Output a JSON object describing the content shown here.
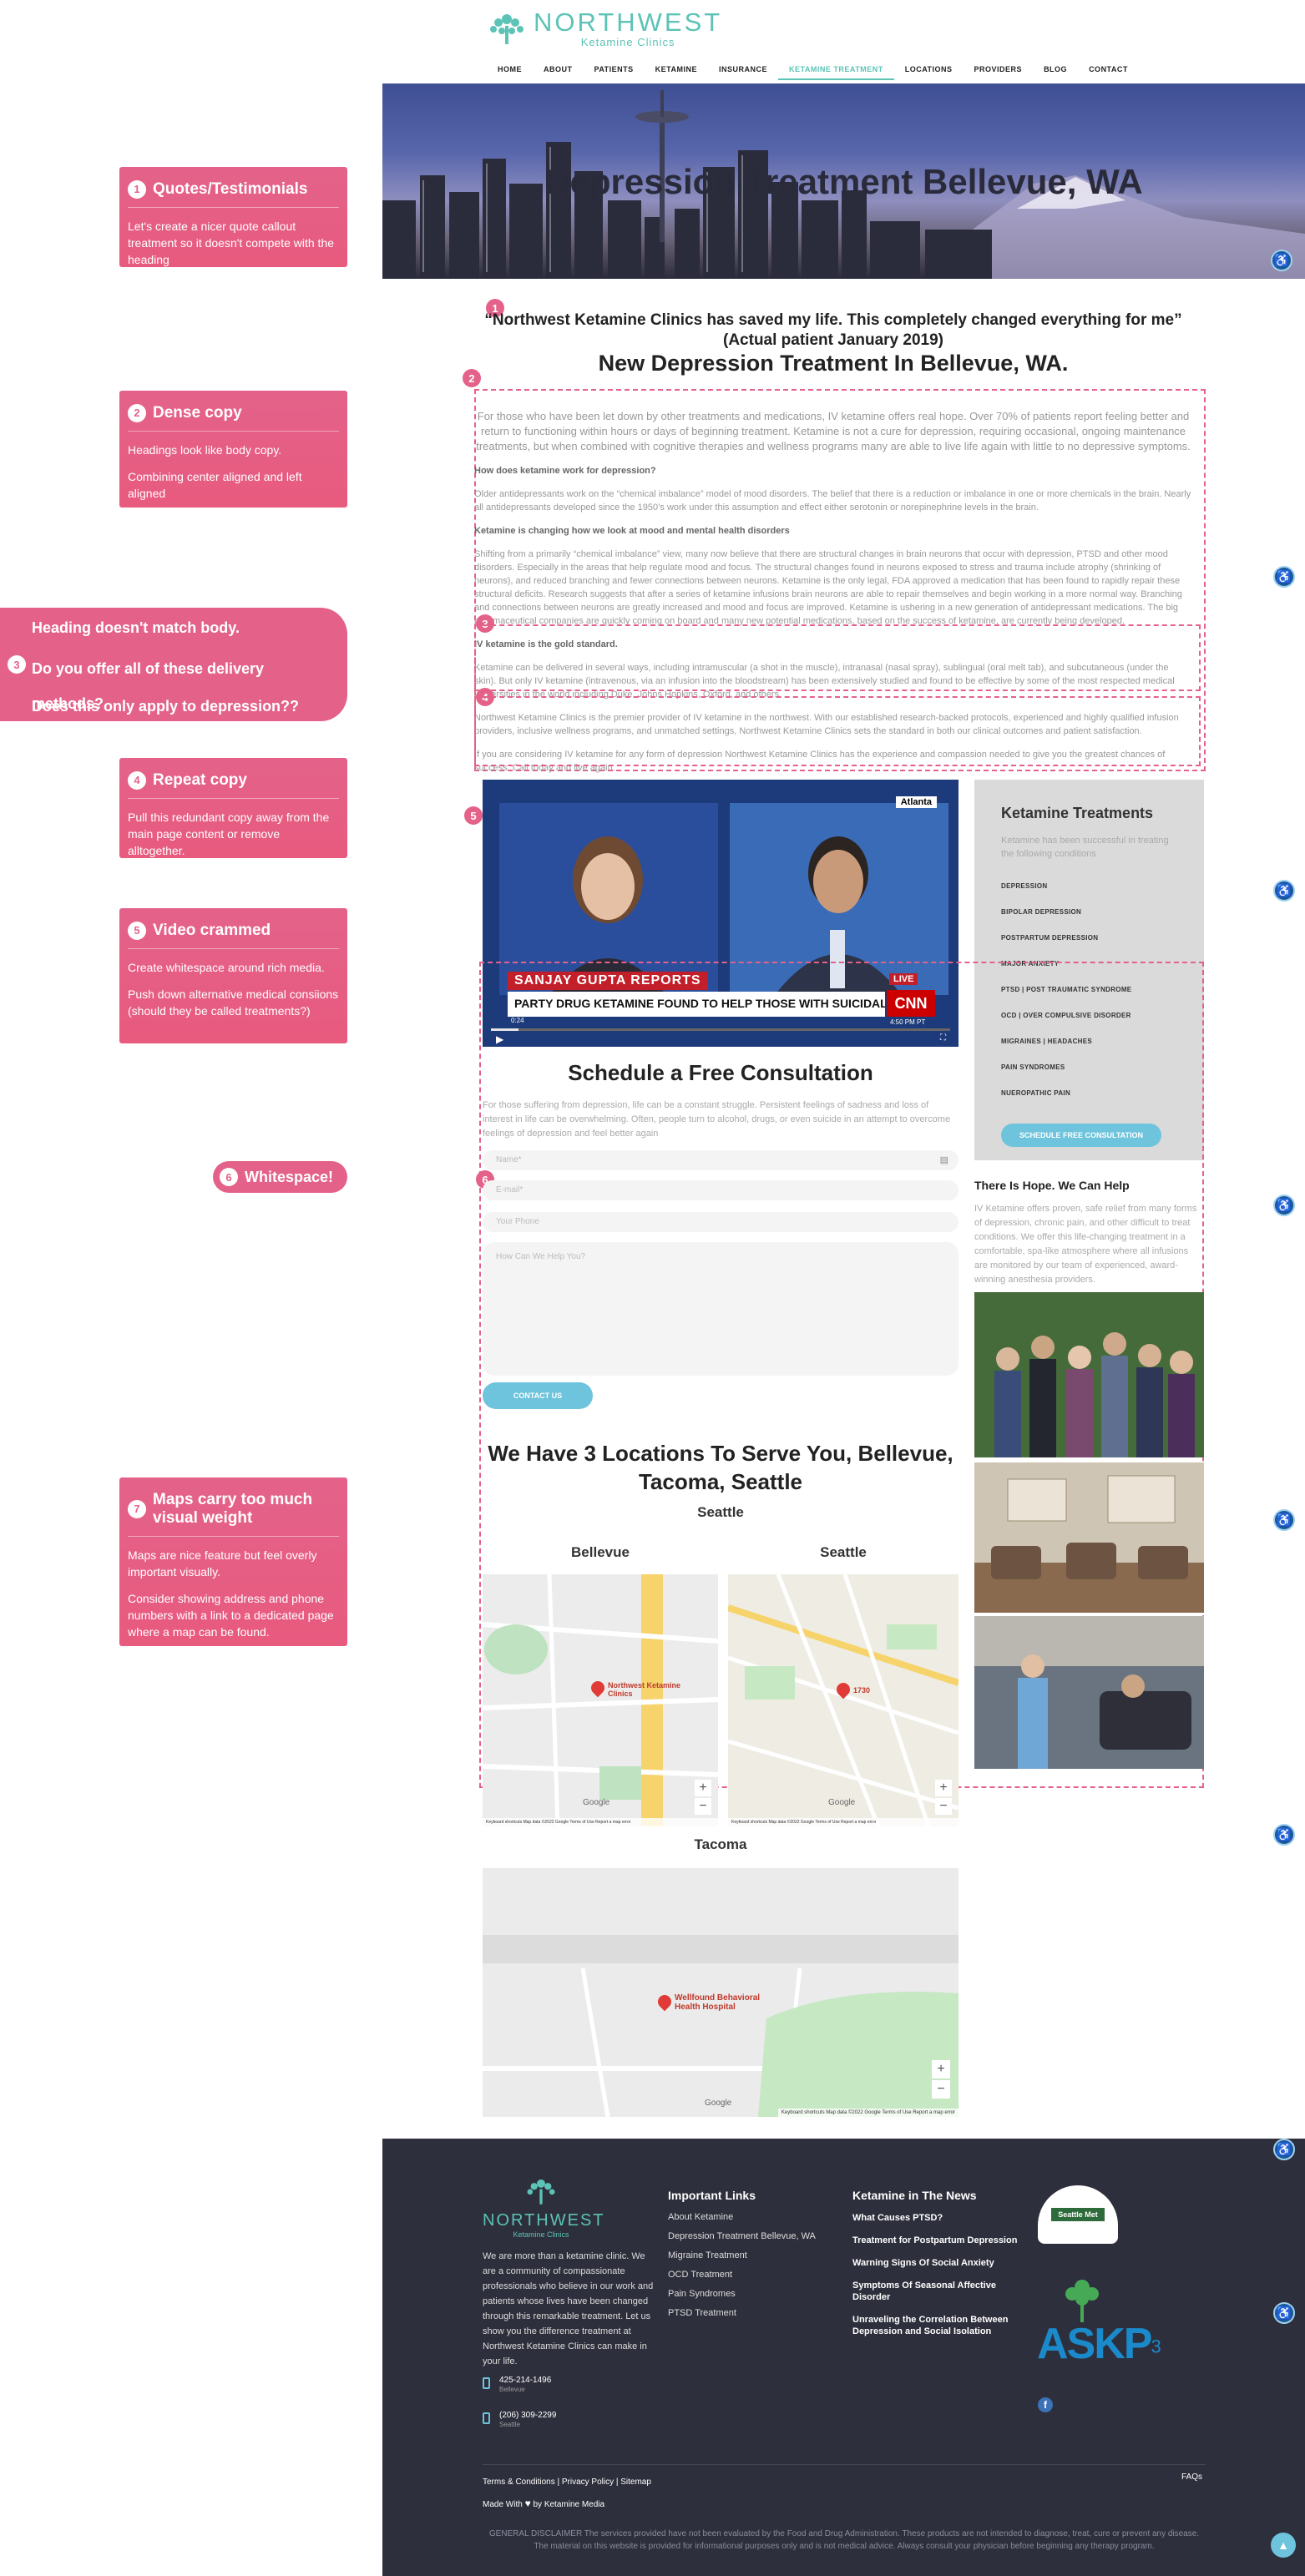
{
  "annotations": [
    {
      "num": "1",
      "title": "Quotes/Testimonials",
      "body": [
        "Let's create a nicer quote callout treatment so it doesn't compete with the heading"
      ]
    },
    {
      "num": "2",
      "title": "Dense copy",
      "body": [
        "Headings look like body copy.",
        "Combining center aligned and left aligned"
      ]
    },
    {
      "num": "3",
      "lines": [
        "Heading doesn't match body.",
        "Do you offer all of these delivery methods?",
        "Does this only apply to depression??"
      ]
    },
    {
      "num": "4",
      "title": "Repeat copy",
      "body": [
        "Pull this redundant copy away from the main page content or remove alltogether."
      ]
    },
    {
      "num": "5",
      "title": "Video crammed",
      "body": [
        "Create whitespace around rich media.",
        "Push down alternative medical consiions (should they be called treatments?)"
      ]
    },
    {
      "num": "6",
      "title": "Whitespace!"
    },
    {
      "num": "7",
      "title": "Maps carry too much visual weight",
      "body": [
        "Maps are nice feature but feel overly important visually.",
        "Consider showing address and phone numbers with a link to a dedicated page where a map can be found."
      ]
    }
  ],
  "logo": {
    "name": "NORTHWEST",
    "sub": "Ketamine Clinics"
  },
  "nav": [
    "HOME",
    "ABOUT",
    "PATIENTS",
    "KETAMINE",
    "INSURANCE",
    "KETAMINE TREATMENT",
    "LOCATIONS",
    "PROVIDERS",
    "BLOG",
    "CONTACT"
  ],
  "nav_active": "KETAMINE TREATMENT",
  "hero_title": "Depression Treatment Bellevue, WA",
  "quote": "“Northwest Ketamine Clinics has saved my life. This completely changed everything for me” (Actual patient January 2019)",
  "main_heading": "New Depression Treatment In Bellevue, WA.",
  "copy": {
    "lead": "For those who have been let down by other treatments and medications, IV ketamine offers real hope. Over 70% of patients report feeling better and return to functioning within hours or days of beginning treatment. Ketamine is not a cure for depression, requiring occasional, ongoing maintenance treatments, but when combined with cognitive therapies and wellness programs many are able to live life again with little to no depressive symptoms.",
    "h_work": "How does ketamine work for depression?",
    "p_work": "Older antidepressants work on the “chemical imbalance” model of mood disorders. The belief that there is a reduction or imbalance in one or more chemicals in the brain. Nearly all antidepressants developed since the 1950’s work under this assumption and effect either serotonin or norepinephrine levels in the brain.",
    "h_changing": "Ketamine is changing how we look at mood and mental health disorders",
    "p_changing": "Shifting from a primarily “chemical imbalance” view, many now believe that there are structural changes in brain neurons that occur with depression, PTSD and other mood disorders. Especially in the areas that help regulate mood and focus. The structural changes found in neurons exposed to stress and trauma include atrophy (shrinking of neurons), and reduced branching and fewer connections between neurons. Ketamine is the only legal, FDA approved a medication that has been found to rapidly repair these structural deficits. Research suggests that after a series of ketamine infusions brain neurons are able to repair themselves and begin working in a more normal way. Branching and connections between neurons are greatly increased and mood and focus are improved. Ketamine is ushering in a new generation of antidepressant medications. The big pharmaceutical companies are quickly coming on board and many new potential medications, based on the success of ketamine, are currently being developed.",
    "h_gold": "IV ketamine is the gold standard.",
    "p_gold": "Ketamine can be delivered in several ways, including intramuscular (a shot in the muscle), intranasal (nasal spray), sublingual (oral melt tab), and subcutaneous (under the skin). But only IV ketamine (intravenous, via an infusion into the bloodstream) has been extensively studied and found to be effective by some of the most respected medical universities in the world including Duke, Johns Hopkins, Oxford, and others.",
    "p_premier": "Northwest Ketamine Clinics is the premier provider of IV ketamine in the northwest. With our established research-backed protocols, experienced and highly qualified infusion providers, inclusive wellness programs, and unmatched settings, Northwest Ketamine Clinics sets the standard in both our clinical outcomes and patient satisfaction.",
    "p_considering": "If you are considering IV ketamine for any form of depression Northwest Ketamine Clinics has the experience and compassion needed to give you the greatest chances of success. Call today and live again."
  },
  "video": {
    "tag": "Atlanta",
    "banner": "SANJAY GUPTA REPORTS",
    "headline": "PARTY DRUG KETAMINE FOUND TO HELP THOSE WITH SUICIDAL THOUGHTS",
    "live": "LIVE",
    "network": "CNN",
    "time": "4:50 PM PT",
    "elapsed": "0:24"
  },
  "sidebar": {
    "title": "Ketamine Treatments",
    "intro": "Ketamine has been successful in treating the following conditions",
    "items": [
      "DEPRESSION",
      "BIPOLAR DEPRESSION",
      "POSTPARTUM DEPRESSION",
      "MAJOR ANXIETY",
      "PTSD | POST TRAUMATIC SYNDROME",
      "OCD | OVER COMPULSIVE DISORDER",
      "MIGRAINES | HEADACHES",
      "PAIN SYNDROMES",
      "NUEROPATHIC PAIN"
    ],
    "button": "SCHEDULE FREE CONSULTATION",
    "hope_title": "There Is Hope. We Can Help",
    "hope_body": "IV Ketamine offers proven, safe relief from many forms of depression, chronic pain, and other difficult to treat conditions. We offer this life-changing treatment in a comfortable, spa-like atmosphere where all infusions are monitored by our team of experienced, award-winning anesthesia providers."
  },
  "consult": {
    "title": "Schedule a Free Consultation",
    "body": "For those suffering from depression, life can be a constant struggle. Persistent feelings of sadness and loss of interest in life can be overwhelming. Often, people turn to alcohol, drugs, or even suicide in an attempt to overcome feelings of depression and feel better again",
    "name": "Name*",
    "email": "E-mail*",
    "phone": "Your Phone",
    "message": "How Can We Help You?",
    "button": "CONTACT US"
  },
  "locations": {
    "title": "We Have 3 Locations To Serve You, Bellevue, Tacoma, Seattle",
    "top_label": "Seattle",
    "map1": "Bellevue",
    "map2": "Seattle",
    "map3": "Tacoma",
    "map1_pin": "Northwest Ketamine Clinics",
    "map2_pin": "1730",
    "map3_pin": "Wellfound Behavioral Health Hospital",
    "attrib": "Keyboard shortcuts   Map data ©2022 Google   Terms of Use   Report a map error",
    "google": "Google"
  },
  "footer": {
    "about": "We are more than a ketamine clinic. We are a community of compassionate professionals who believe in our work and patients whose lives have been changed through this remarkable treatment. Let us show you the difference treatment at Northwest Ketamine Clinics can make in your life.",
    "phone1": "425-214-1496",
    "phone1_city": "Bellevue",
    "phone2": "(206) 309-2299",
    "phone2_city": "Seattle",
    "links_title": "Important Links",
    "links": [
      "About Ketamine",
      "Depression Treatment Bellevue, WA",
      "Migraine Treatment",
      "OCD Treatment",
      "Pain Syndromes",
      "PTSD Treatment"
    ],
    "news_title": "Ketamine in The News",
    "news": [
      "What Causes PTSD?",
      "Treatment for Postpartum Depression",
      "Warning Signs Of Social Anxiety",
      "Symptoms Of Seasonal Affective Disorder",
      "Unraveling the Correlation Between Depression and Social Isolation"
    ],
    "seal": "Seattle Met",
    "askp": "ASKP",
    "askp_sup": "3",
    "terms": "Terms & Conditions | Privacy Policy | Sitemap",
    "made": "Made With",
    "made_by": "by Ketamine Media",
    "faqs": "FAQs",
    "disclaimer": "GENERAL DISCLAIMER The services provided have not been evaluated by the Food and Drug Administration. These products are not intended to diagnose, treat, cure or prevent any disease. The material on this website is provided for informational purposes only and is not medical advice. Always consult your physician before beginning any therapy program."
  },
  "colors": {
    "accent": "#e4628a",
    "brand": "#5cc3b6",
    "button": "#6ec4dc",
    "footer": "#2e2f3c"
  }
}
